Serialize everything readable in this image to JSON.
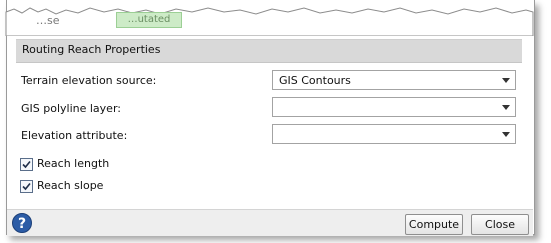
{
  "partial_top": {
    "cut_text": "…se",
    "cut_tab_label": "…utated"
  },
  "section": {
    "title": "Routing Reach Properties"
  },
  "fields": [
    {
      "label": "Terrain elevation source:",
      "value": "GIS Contours"
    },
    {
      "label": "GIS polyline layer:",
      "value": ""
    },
    {
      "label": "Elevation attribute:",
      "value": ""
    }
  ],
  "checkboxes": [
    {
      "label": "Reach length",
      "checked": true
    },
    {
      "label": "Reach slope",
      "checked": true
    }
  ],
  "footer": {
    "help_label": "?",
    "compute_label": "Compute",
    "close_label": "Close"
  },
  "colors": {
    "header_bg": "#d9d9d9",
    "help_blue": "#2c5ca6",
    "footer_bg": "#eeeeee"
  }
}
